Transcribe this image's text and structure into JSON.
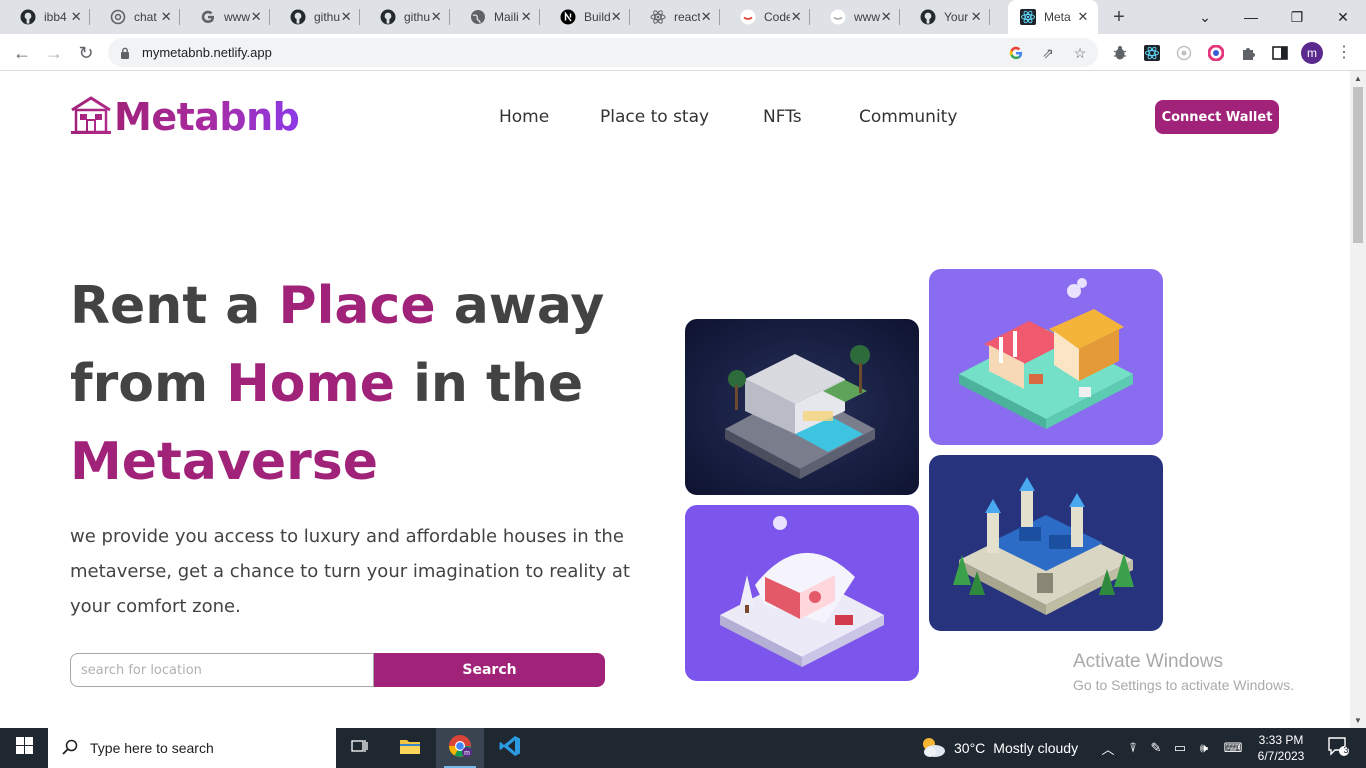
{
  "browser": {
    "tabs": [
      {
        "title": "ibb4",
        "icon": "github-icon"
      },
      {
        "title": "chat",
        "icon": "openai-icon"
      },
      {
        "title": "www",
        "icon": "google-icon"
      },
      {
        "title": "githu",
        "icon": "github-icon"
      },
      {
        "title": "githu",
        "icon": "github-icon"
      },
      {
        "title": "Maili",
        "icon": "globe-icon"
      },
      {
        "title": "Build",
        "icon": "nextjs-icon"
      },
      {
        "title": "react",
        "icon": "react-icon"
      },
      {
        "title": "Code",
        "icon": "codepen-icon"
      },
      {
        "title": "www",
        "icon": "smile-icon"
      },
      {
        "title": "Your",
        "icon": "github-icon"
      },
      {
        "title": "Meta",
        "icon": "react-icon",
        "active": true
      }
    ],
    "url": "mymetabnb.netlify.app"
  },
  "site": {
    "logo_text": "Metabnb",
    "nav": [
      "Home",
      "Place to stay",
      "NFTs",
      "Community"
    ],
    "connect_label": "Connect Wallet",
    "headline": {
      "l1a": "Rent a ",
      "l1b": "Place",
      "l1c": " away",
      "l2a": "from ",
      "l2b": "Home",
      "l2c": " in the",
      "l3": "Metaverse"
    },
    "lead": "we provide you access to luxury and affordable houses in the metaverse, get a chance to turn your imagination to reality at your comfort zone.",
    "search_placeholder": "search for location",
    "search_label": "Search"
  },
  "watermark": {
    "title": "Activate Windows",
    "subtitle": "Go to Settings to activate Windows."
  },
  "taskbar": {
    "search_text": "Type here to search",
    "weather_temp": "30°C",
    "weather_desc": "Mostly cloudy",
    "time": "3:33 PM",
    "date": "6/7/2023",
    "notifications": "3"
  },
  "colors": {
    "accent": "#a02279",
    "logo_gradient_end": "#8c3ae8",
    "taskbar": "#1f2731"
  }
}
